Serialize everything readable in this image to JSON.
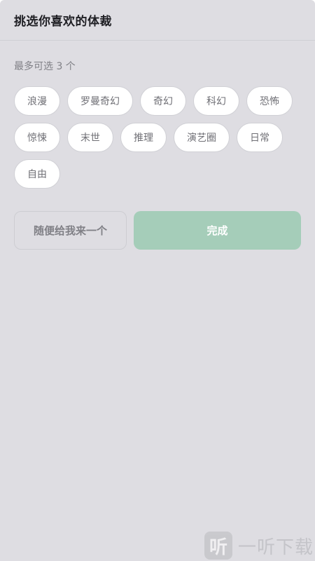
{
  "header": {
    "title": "挑选你喜欢的体裁"
  },
  "hint": "最多可选 3 个",
  "tags": [
    {
      "label": "浪漫"
    },
    {
      "label": "罗曼奇幻"
    },
    {
      "label": "奇幻"
    },
    {
      "label": "科幻"
    },
    {
      "label": "恐怖"
    },
    {
      "label": "惊悚"
    },
    {
      "label": "末世"
    },
    {
      "label": "推理"
    },
    {
      "label": "演艺圈"
    },
    {
      "label": "日常"
    },
    {
      "label": "自由"
    }
  ],
  "actions": {
    "random_label": "随便给我来一个",
    "done_label": "完成"
  },
  "watermark": {
    "logo_glyph": "听",
    "text": "一听下载"
  },
  "colors": {
    "panel_bg": "#dedde2",
    "done_button": "#a5cdb9",
    "tag_bg": "#ffffff"
  }
}
